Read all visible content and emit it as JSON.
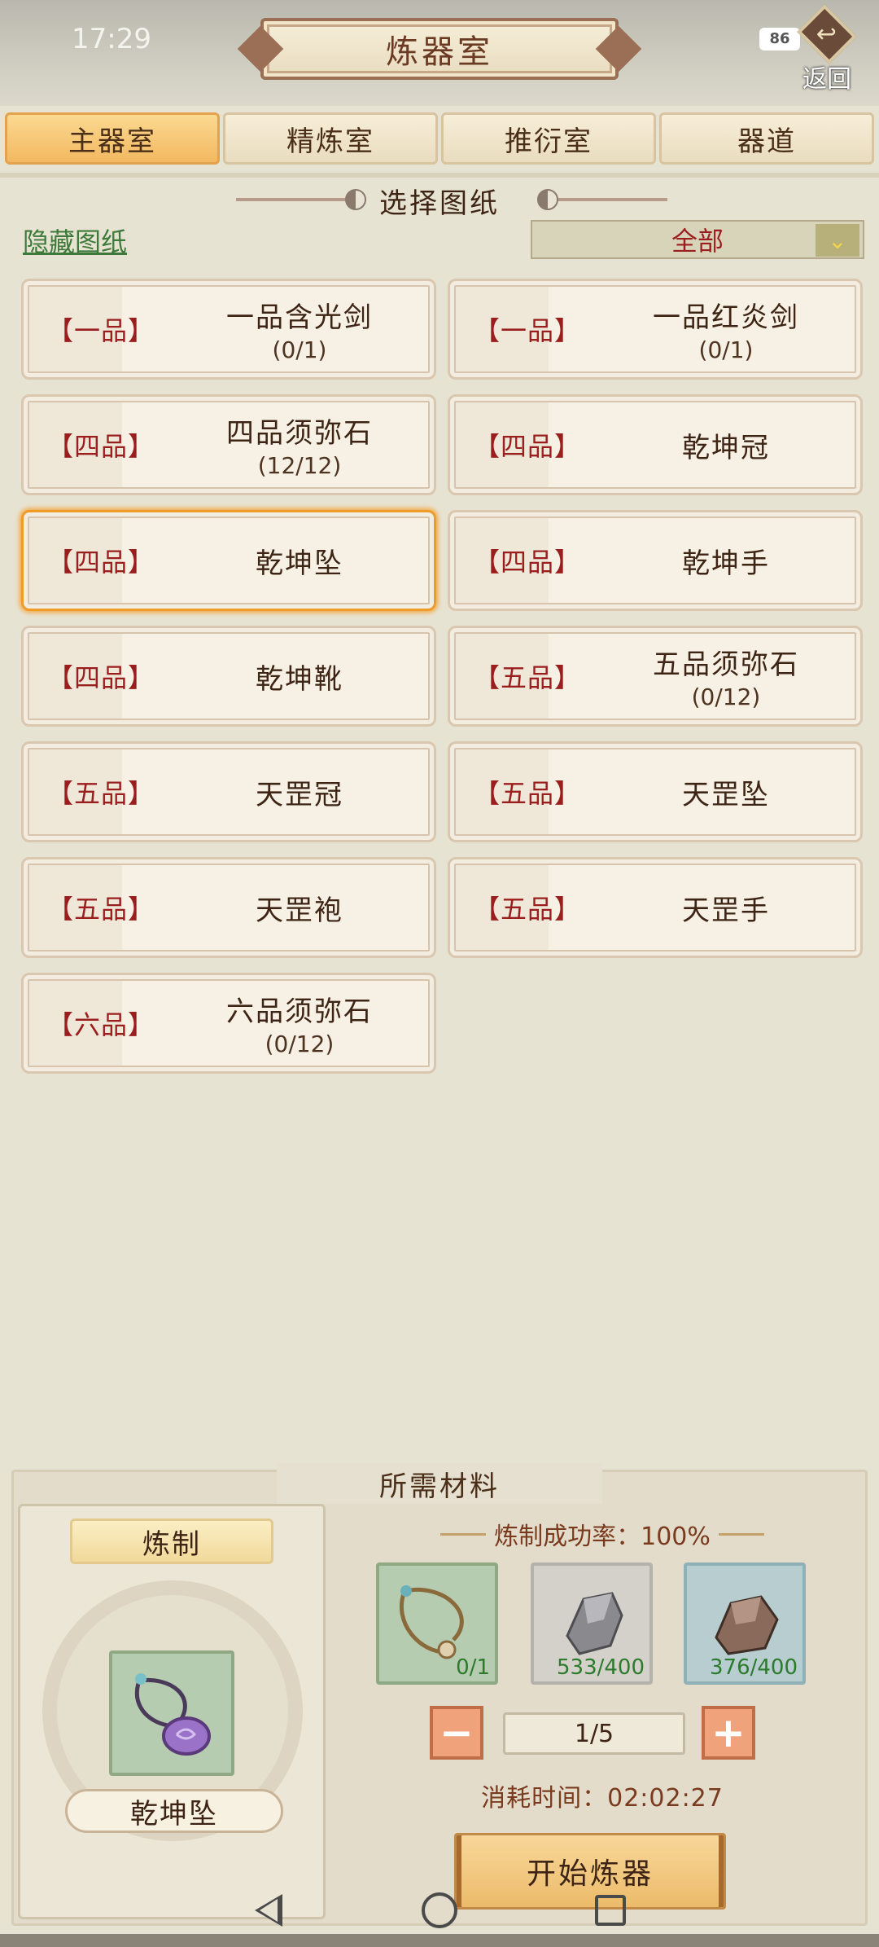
{
  "status_bar": {
    "time": "17:29",
    "battery": "86"
  },
  "header": {
    "title": "炼器室",
    "back_label": "返回"
  },
  "tabs": [
    {
      "label": "主器室",
      "active": true
    },
    {
      "label": "精炼室",
      "active": false
    },
    {
      "label": "推衍室",
      "active": false
    },
    {
      "label": "器道",
      "active": false
    }
  ],
  "section_title": "选择图纸",
  "hide_link": "隐藏图纸",
  "filter": {
    "selected": "全部"
  },
  "blueprints": [
    {
      "grade": "【一品】",
      "name": "一品含光剑",
      "count": "(0/1)"
    },
    {
      "grade": "【一品】",
      "name": "一品红炎剑",
      "count": "(0/1)"
    },
    {
      "grade": "【四品】",
      "name": "四品须弥石",
      "count": "(12/12)"
    },
    {
      "grade": "【四品】",
      "name": "乾坤冠",
      "count": ""
    },
    {
      "grade": "【四品】",
      "name": "乾坤坠",
      "count": "",
      "selected": true
    },
    {
      "grade": "【四品】",
      "name": "乾坤手",
      "count": ""
    },
    {
      "grade": "【四品】",
      "name": "乾坤靴",
      "count": ""
    },
    {
      "grade": "【五品】",
      "name": "五品须弥石",
      "count": "(0/12)"
    },
    {
      "grade": "【五品】",
      "name": "天罡冠",
      "count": ""
    },
    {
      "grade": "【五品】",
      "name": "天罡坠",
      "count": ""
    },
    {
      "grade": "【五品】",
      "name": "天罡袍",
      "count": ""
    },
    {
      "grade": "【五品】",
      "name": "天罡手",
      "count": ""
    },
    {
      "grade": "【六品】",
      "name": "六品须弥石",
      "count": "(0/12)"
    }
  ],
  "materials": {
    "title": "所需材料",
    "craft_label": "炼制",
    "craft_item": "乾坤坠",
    "success_rate": "炼制成功率：100%",
    "slots": [
      {
        "icon": "necklace-icon",
        "count": "0/1"
      },
      {
        "icon": "gray-ore-icon",
        "count": "533/400"
      },
      {
        "icon": "brown-ore-icon",
        "count": "376/400"
      }
    ],
    "quantity": "1/5",
    "time_cost": "消耗时间：02:02:27",
    "start_button": "开始炼器"
  },
  "colors": {
    "accent": "#f3b860",
    "grade_red": "#9a1e1e",
    "link_green": "#3d7a3a"
  }
}
